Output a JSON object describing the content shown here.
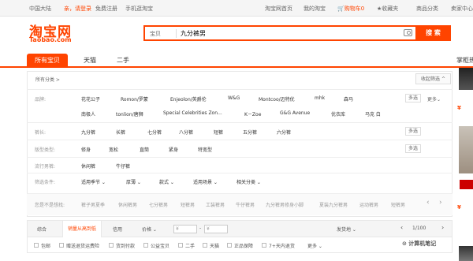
{
  "topbar": {
    "region": "中国大陆",
    "greet": "亲，请登录",
    "register": "免费注册",
    "mobile": "手机逛淘宝",
    "home": "淘宝网首页",
    "my": "我的淘宝",
    "cart": "购物车0",
    "fav": "收藏夹",
    "category": "商品分类",
    "seller": "卖家中心"
  },
  "logo": {
    "cn": "淘宝网",
    "en": "Taobao.com"
  },
  "search": {
    "type": "宝贝",
    "query": "九分裤男",
    "button": "搜 索"
  },
  "tabs": [
    "所有宝贝",
    "天猫",
    "二手"
  ],
  "panel": {
    "crumb": "所有分类 >",
    "stow": "收起筛选 ^",
    "rows": {
      "brand": {
        "label": "品牌:",
        "line1": [
          "花花公子",
          "Romon/罗蒙",
          "Enjeolon/英爵伦",
          "W&G",
          "Montcoo/迈特优",
          "mhk",
          "森马"
        ],
        "line2": [
          "南极人",
          "tonlion/唐狮",
          "Special Celebrities Zon...",
          "K－Zoe",
          "G&G Avenue",
          "优衣库",
          "马克 白"
        ],
        "multi": "多选",
        "more": "更多⌄"
      },
      "length": {
        "label": "裤长:",
        "items": [
          "九分裤",
          "长裤",
          "七分裤",
          "八分裤",
          "短裤",
          "五分裤",
          "六分裤"
        ],
        "multi": "多选"
      },
      "fit": {
        "label": "版型类型:",
        "items": [
          "修身",
          "宽松",
          "直筒",
          "紧身",
          "特宽型"
        ],
        "multi": "多选"
      },
      "popular": {
        "label": "流行男裤:",
        "items": [
          "休闲裤",
          "牛仔裤"
        ]
      },
      "conditions": {
        "label": "筛选条件:",
        "items": [
          "适用季节 ⌄",
          "厚薄 ⌄",
          "款式 ⌄",
          "适用场景 ⌄",
          "相关分类 ⌄"
        ]
      },
      "suggest": {
        "label": "您是不是想找:",
        "items": [
          "裤子男夏季",
          "休闲裤男",
          "七分裤男",
          "短裤男",
          "工装裤男",
          "牛仔裤男",
          "九分裤男修身小脚",
          "夏装九分裤男",
          "运动裤男",
          "短裤男"
        ]
      }
    }
  },
  "sortbar": {
    "items": [
      "综合",
      "销量从高到低",
      "信用",
      "价格 ⌄"
    ],
    "price_from": "¥",
    "price_to": "¥",
    "ship_from": "发货地 ⌄",
    "page": "1/100"
  },
  "filterbar": {
    "items": [
      "包邮",
      "赠送退货运费险",
      "货到付款",
      "公益宝贝",
      "二手",
      "天猫",
      "正品保障",
      "7+天内退货",
      "更多 ⌄"
    ]
  },
  "right": {
    "title": "掌柜热卖",
    "price1": "¥",
    "price2": "¥"
  },
  "watermark": "⊙ 计算机笔记"
}
